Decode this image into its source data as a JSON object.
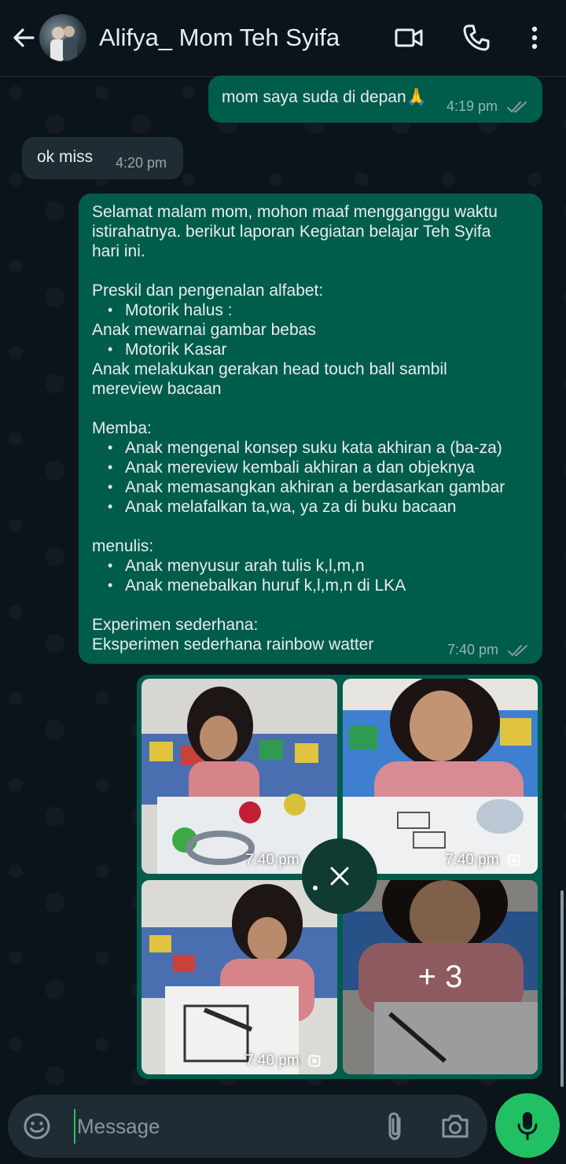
{
  "header": {
    "contact_name": "Alifya_ Mom Teh Syifa"
  },
  "messages": {
    "m1": {
      "text": "mom saya suda di depan🙏",
      "time": "4:19 pm"
    },
    "m2": {
      "text": "ok miss",
      "time": "4:20 pm"
    },
    "m3": {
      "intro": "Selamat malam mom, mohon maaf mengganggu waktu istirahatnya. berikut laporan Kegiatan belajar Teh Syifa hari ini.",
      "section1_title": "Preskil dan pengenalan alfabet:",
      "s1_b1": "Motorik halus :",
      "s1_t1": "Anak mewarnai gambar bebas",
      "s1_b2": "Motorik Kasar",
      "s1_t2": "Anak melakukan gerakan head touch ball sambil mereview bacaan",
      "section2_title": "Memba:",
      "s2_items": [
        "Anak mengenal konsep suku kata akhiran a (ba-za)",
        "Anak mereview kembali akhiran a dan objeknya",
        "Anak memasangkan akhiran a berdasarkan gambar",
        "Anak melafalkan ta,wa, ya za di buku bacaan"
      ],
      "section3_title": "menulis:",
      "s3_items": [
        "Anak menyusur arah tulis k,l,m,n",
        "Anak menebalkan huruf k,l,m,n di LKA"
      ],
      "section4_title": "Experimen sederhana:",
      "s4_text": "Eksperimen sederhana rainbow watter",
      "time": "7:40 pm"
    }
  },
  "album": {
    "photos": [
      {
        "time": "7:40 pm"
      },
      {
        "time": "7:40 pm"
      },
      {
        "time": "7:40 pm"
      },
      {
        "more": "+ 3"
      }
    ]
  },
  "composer": {
    "placeholder": "Message"
  },
  "colors": {
    "outgoing_bubble": "#005c4b",
    "incoming_bubble": "#202c33",
    "accent": "#21c063"
  }
}
